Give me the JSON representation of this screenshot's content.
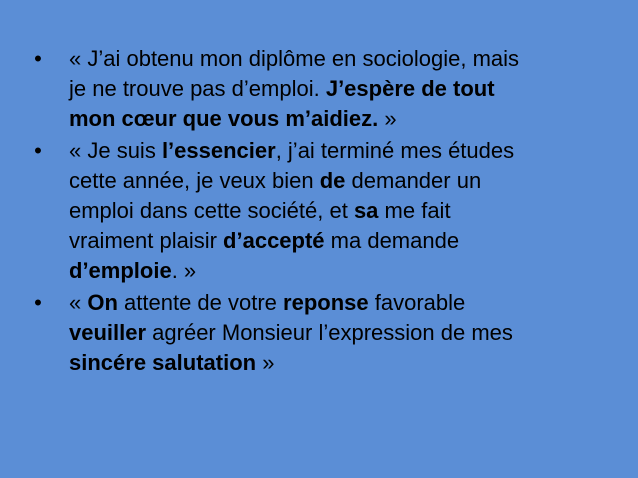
{
  "bullets": [
    {
      "lines": [
        [
          {
            "text": "« J’ai obtenu mon diplôme en sociologie, mais",
            "bold": false
          }
        ],
        [
          {
            "text": "je ne trouve pas d’emploi. ",
            "bold": false
          },
          {
            "text": "J’espère de tout",
            "bold": true
          }
        ],
        [
          {
            "text": "mon cœur que vous m’aidiez.",
            "bold": true
          },
          {
            "text": " »",
            "bold": false
          }
        ]
      ]
    },
    {
      "lines": [
        [
          {
            "text": "« Je suis ",
            "bold": false
          },
          {
            "text": "l’essencier",
            "bold": true
          },
          {
            "text": ", j’ai terminé mes études",
            "bold": false
          }
        ],
        [
          {
            "text": "cette année, je veux bien ",
            "bold": false
          },
          {
            "text": "de",
            "bold": true
          },
          {
            "text": " demander un",
            "bold": false
          }
        ],
        [
          {
            "text": "emploi dans cette société, et ",
            "bold": false
          },
          {
            "text": "sa",
            "bold": true
          },
          {
            "text": " me fait",
            "bold": false
          }
        ],
        [
          {
            "text": "vraiment plaisir ",
            "bold": false
          },
          {
            "text": "d’accepté",
            "bold": true
          },
          {
            "text": " ma demande",
            "bold": false
          }
        ],
        [
          {
            "text": "d’emploie",
            "bold": true
          },
          {
            "text": ". »",
            "bold": false
          }
        ]
      ]
    },
    {
      "lines": [
        [
          {
            "text": "« ",
            "bold": false
          },
          {
            "text": "On",
            "bold": true
          },
          {
            "text": " attente de votre ",
            "bold": false
          },
          {
            "text": "reponse",
            "bold": true
          },
          {
            "text": " favorable",
            "bold": false
          }
        ],
        [
          {
            "text": "veuiller",
            "bold": true
          },
          {
            "text": " agréer Monsieur l’expression de mes",
            "bold": false
          }
        ],
        [
          {
            "text": "sincére salutation",
            "bold": true
          },
          {
            "text": " »",
            "bold": false
          }
        ]
      ]
    }
  ],
  "bullet_symbol": "•"
}
